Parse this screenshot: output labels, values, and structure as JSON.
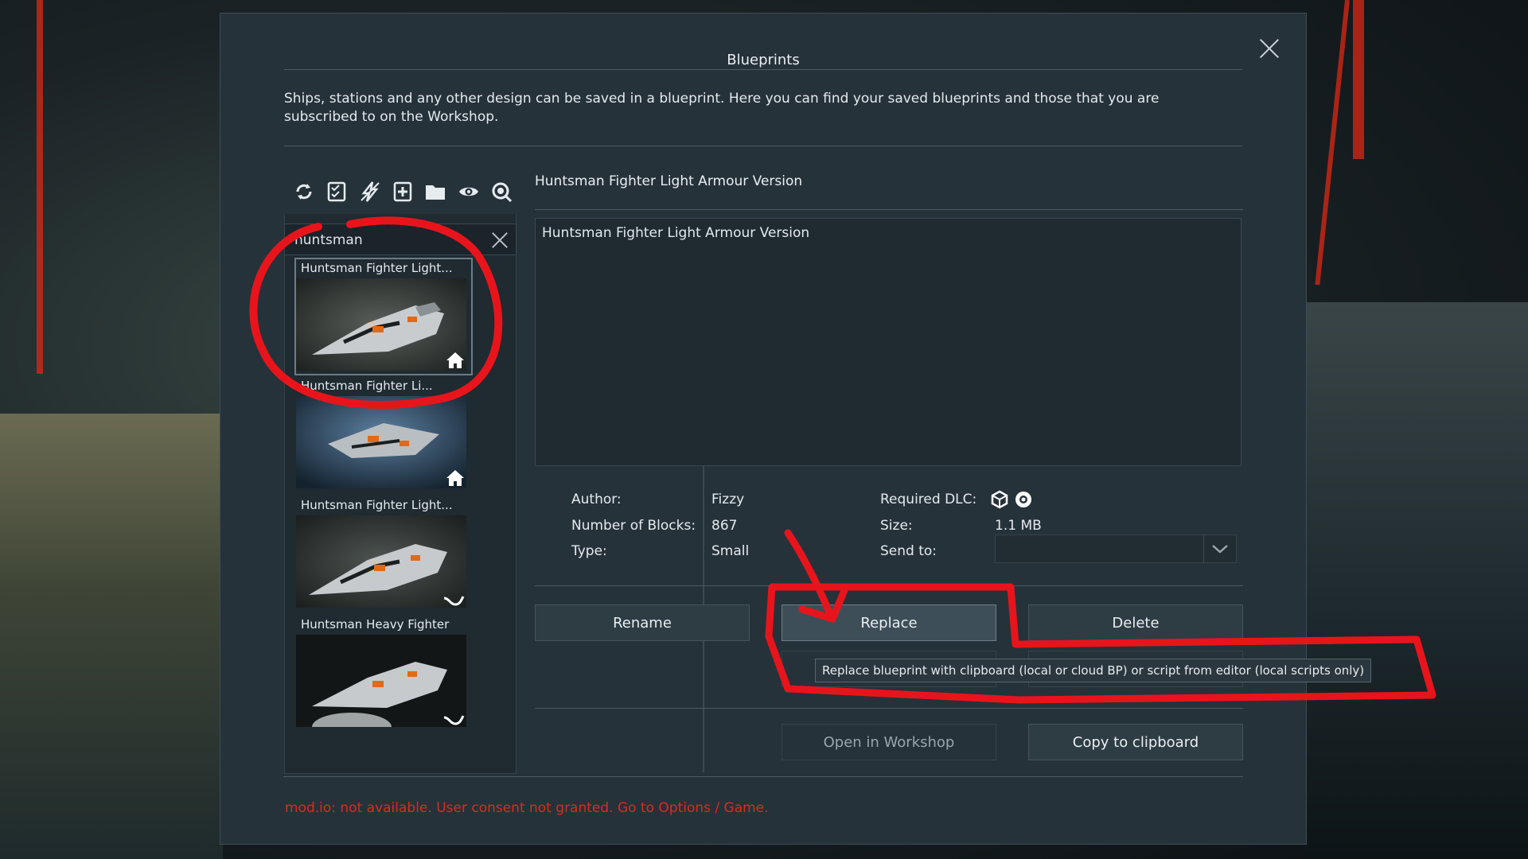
{
  "dialog": {
    "title": "Blueprints",
    "description": "Ships, stations and any other design can be saved in a blueprint. Here you can find your saved blueprints and those that you are subscribed to on the Workshop."
  },
  "toolbar": {
    "icons": [
      "refresh-icon",
      "checklist-icon",
      "lightning-icon",
      "new-blueprint-icon",
      "folder-icon",
      "eye-icon",
      "search-icon"
    ]
  },
  "search": {
    "value": "huntsman"
  },
  "blueprints": [
    {
      "name": "Huntsman Fighter Light...",
      "source_icon": "home-icon"
    },
    {
      "name": "Huntsman Fighter Li...",
      "source_icon": "home-icon"
    },
    {
      "name": "Huntsman Fighter Light...",
      "source_icon": "steam-icon"
    },
    {
      "name": "Huntsman Heavy Fighter",
      "source_icon": "steam-icon"
    }
  ],
  "detail": {
    "title": "Huntsman Fighter Light Armour Version",
    "description": "Huntsman Fighter Light Armour Version",
    "author_label": "Author:",
    "author": "Fizzy",
    "blocks_label": "Number of Blocks:",
    "blocks": "867",
    "type_label": "Type:",
    "type": "Small",
    "dlc_label": "Required DLC:",
    "size_label": "Size:",
    "size": "1.1 MB",
    "send_label": "Send to:"
  },
  "buttons": {
    "rename": "Rename",
    "replace": "Replace",
    "delete": "Delete",
    "open_workshop": "Open in Workshop",
    "copy_clipboard": "Copy to clipboard"
  },
  "tooltip": "Replace blueprint with clipboard (local or cloud BP) or script from editor (local scripts only)",
  "modio_status": "mod.io: not available. User consent not granted. Go to Options / Game.",
  "colors": {
    "annotation": "#e8141c",
    "status_error": "#e0291c"
  }
}
